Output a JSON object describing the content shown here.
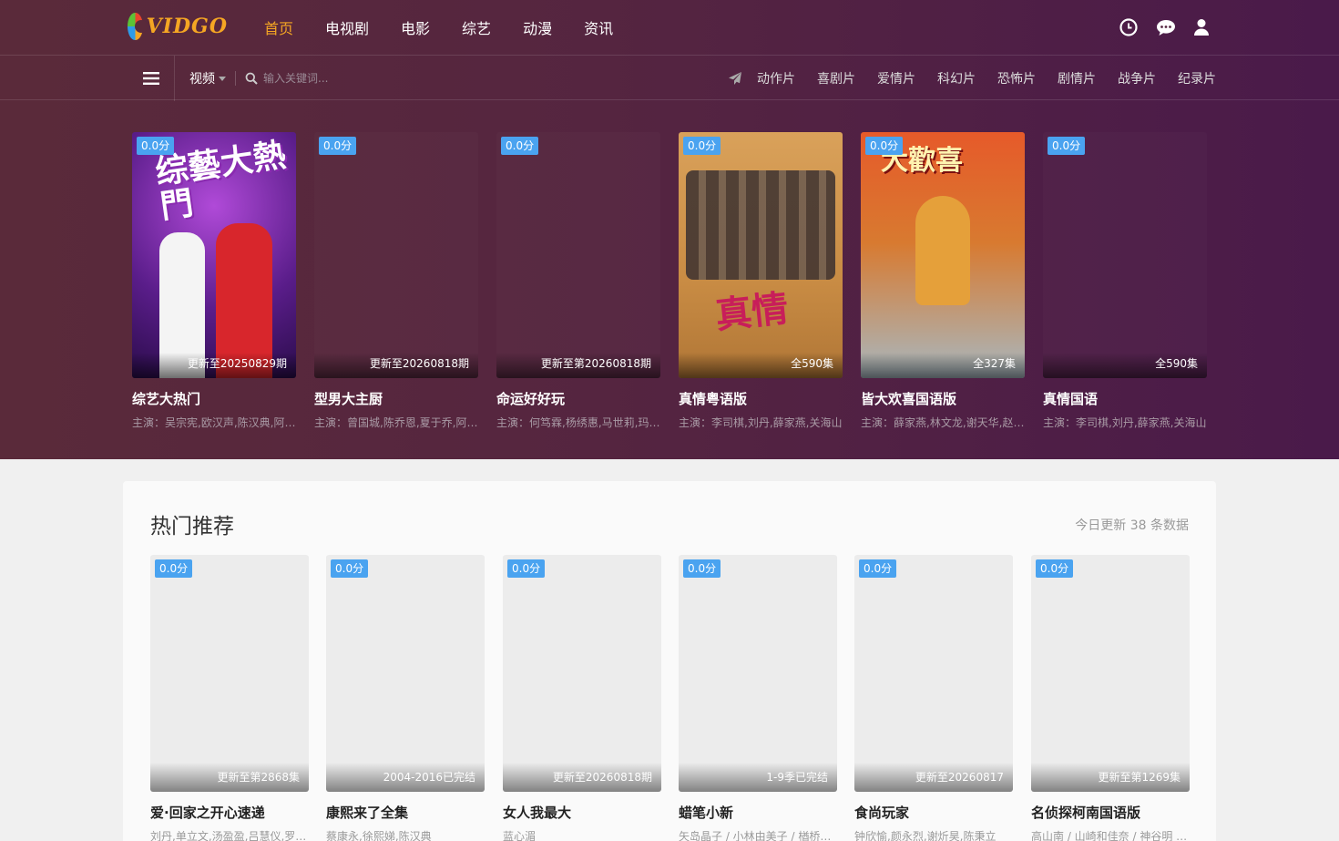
{
  "logo": {
    "text": "VIDGO"
  },
  "nav": [
    {
      "label": "首页",
      "active": true
    },
    {
      "label": "电视剧"
    },
    {
      "label": "电影"
    },
    {
      "label": "综艺"
    },
    {
      "label": "动漫"
    },
    {
      "label": "资讯"
    }
  ],
  "search": {
    "category": "视频",
    "placeholder": "输入关键词..."
  },
  "genres": [
    "动作片",
    "喜剧片",
    "爱情片",
    "科幻片",
    "恐怖片",
    "剧情片",
    "战争片",
    "纪录片"
  ],
  "hero": [
    {
      "score": "0.0分",
      "note": "更新至20250829期",
      "title": "综艺大热门",
      "cast": "主演：吴宗宪,欧汉声,陈汉典,阿KEN",
      "art": "zongyi",
      "art_text": "综藝大熱門"
    },
    {
      "score": "0.0分",
      "note": "更新至20260818期",
      "title": "型男大主厨",
      "cast": "主演：曾国城,陈乔恩,夏于乔,阿Ken"
    },
    {
      "score": "0.0分",
      "note": "更新至第20260818期",
      "title": "命运好好玩",
      "cast": "主演：何笃霖,杨绣惠,马世莉,玛丽亚"
    },
    {
      "score": "0.0分",
      "note": "全590集",
      "title": "真情粤语版",
      "cast": "主演：李司棋,刘丹,薛家燕,关海山",
      "art": "zhenqing",
      "art_text": "真情"
    },
    {
      "score": "0.0分",
      "note": "全327集",
      "title": "皆大欢喜国语版",
      "cast": "主演：薛家燕,林文龙,谢天华,赵学而",
      "art": "dahuanxi",
      "art_text": "大歡喜"
    },
    {
      "score": "0.0分",
      "note": "全590集",
      "title": "真情国语",
      "cast": "主演：李司棋,刘丹,薛家燕,关海山"
    }
  ],
  "recommend": {
    "title": "热门推荐",
    "meta": "今日更新 38 条数据",
    "items": [
      {
        "score": "0.0分",
        "note": "更新至第2868集",
        "title": "爱·回家之开心速递",
        "cast": "刘丹,单立文,汤盈盈,吕慧仪,罗乐林"
      },
      {
        "score": "0.0分",
        "note": "2004-2016已完结",
        "title": "康熙来了全集",
        "cast": "蔡康永,徐熙娣,陈汉典"
      },
      {
        "score": "0.0分",
        "note": "更新至20260818期",
        "title": "女人我最大",
        "cast": "蓝心湄"
      },
      {
        "score": "0.0分",
        "note": "1-9季已完结",
        "title": "蜡笔小新",
        "cast": "矢岛晶子 / 小林由美子 / 楢桥美纪"
      },
      {
        "score": "0.0分",
        "note": "更新至20260817",
        "title": "食尚玩家",
        "cast": "钟欣愉,颜永烈,谢炘昊,陈秉立"
      },
      {
        "score": "0.0分",
        "note": "更新至第1269集",
        "title": "名侦探柯南国语版",
        "cast": "高山南 / 山崎和佳奈 / 神谷明 / 茅野爱衣"
      }
    ]
  },
  "colors": {
    "accent": "#f5a623",
    "score_badge": "#4aa3f0",
    "hero_bg": "#552540"
  }
}
